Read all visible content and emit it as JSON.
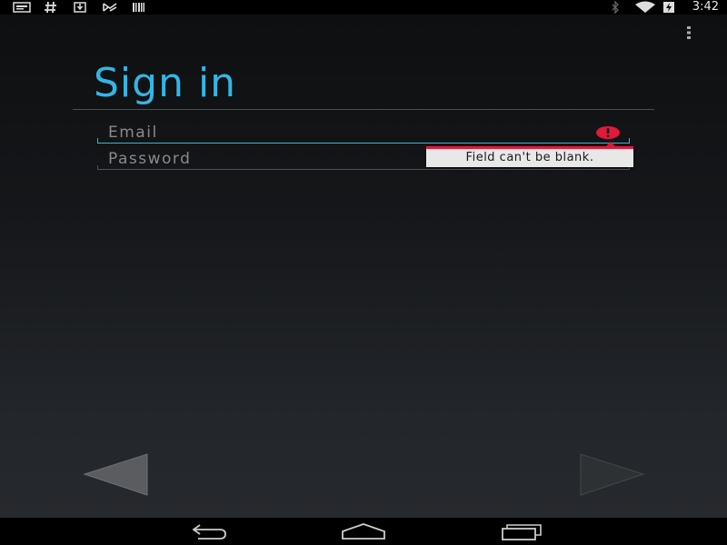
{
  "status_bar": {
    "time": "3:42",
    "left_icons": [
      "message-icon",
      "hash-icon",
      "download-icon",
      "gmail-icon",
      "barcode-icon"
    ],
    "right_icons": [
      "bluetooth-icon",
      "wifi-icon",
      "battery-charging-icon"
    ]
  },
  "page": {
    "title": "Sign in",
    "accent_color": "#33b5e5"
  },
  "form": {
    "email": {
      "placeholder": "Email",
      "value": ""
    },
    "password": {
      "placeholder": "Password",
      "value": ""
    },
    "error": {
      "message": "Field can't be blank.",
      "color": "#e2193a"
    }
  },
  "navigation": {
    "prev_icon": "left-arrow-icon",
    "next_icon": "right-arrow-icon"
  },
  "system_nav": {
    "buttons": [
      "back-icon",
      "home-icon",
      "recent-apps-icon"
    ]
  }
}
